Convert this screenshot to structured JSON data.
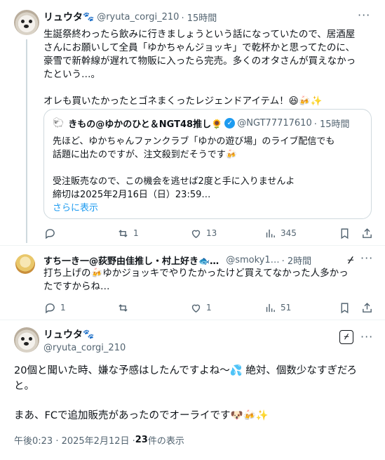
{
  "tweet1": {
    "name": "リュウタ",
    "name_emoji": "🐾",
    "handle": "@ryuta_corgi_210",
    "time": "· 15時間",
    "lines": [
      "生誕祭終わったら飲みに行きましょうという話になっていたので、居酒屋",
      "さんにお願いして全員「ゆかちゃんジョッキ」で乾杯かと思ってたのに、",
      "豪雪で新幹線が遅れて物販に入ったら完売。多くのオタさんが買えなかっ",
      "たという…。",
      "オレも買いたかったとゴネまくったレジェンドアイテム！😆🍻✨"
    ],
    "actions": {
      "reply": "",
      "retweet": "1",
      "like": "13",
      "views": "345"
    }
  },
  "quote": {
    "name": "きもの@ゆかのひと＆NGT48推し🌻",
    "name_prefix_emoji": "🐑",
    "handle": "@NGT77717610",
    "time": "· 15時間",
    "lines": [
      "先ほど、ゆかちゃんファンクラブ「ゆかの遊び場」のライブ配信でも",
      "話題に出たのですが、注文殺到だそうです🍻",
      "受注販売なので、この機会を逃せば2度と手に入りませんよ",
      "締切は2025年2月16日（日）23:59…"
    ],
    "show_more": "さらに表示"
  },
  "tweet2": {
    "name": "すち一き一@荻野由佳推し・村上好き🐟…",
    "handle": "@smoky1…",
    "time": "· 2時間",
    "lines": [
      "打ち上げの🍻ゆかジョッキでやりたかったけど買えてなかった人多かっ",
      "たですからね…"
    ],
    "actions": {
      "reply": "1",
      "retweet": "",
      "like": "1",
      "views": "51"
    }
  },
  "tweet3": {
    "name": "リュウタ",
    "name_emoji": "🐾",
    "handle": "@ryuta_corgi_210",
    "lines": [
      "20個と聞いた時、嫌な予感はしたんですよね～💦 絶対、個数少なすぎだろ",
      "と。",
      "まあ、FCで追加販売があったのでオーライです🐶🍻✨"
    ],
    "meta_time": "午後0:23 · 2025年2月12日 · ",
    "meta_views_count": "23",
    "meta_views_label": " 件の表示"
  },
  "icons": [
    "more-icon",
    "reply-icon",
    "retweet-icon",
    "like-icon",
    "views-icon",
    "bookmark-icon",
    "share-icon",
    "grok-icon",
    "verified-icon"
  ],
  "colors": {
    "accent": "#1d9bf0",
    "muted": "#536471",
    "border": "#cfd9de"
  }
}
